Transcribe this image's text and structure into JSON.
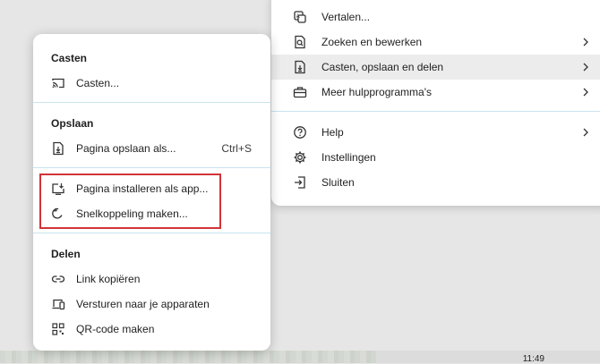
{
  "main_menu": {
    "items": [
      {
        "label": "Vertalen...",
        "icon": "translate-icon",
        "submenu": false
      },
      {
        "label": "Zoeken en bewerken",
        "icon": "search-document-icon",
        "submenu": true
      },
      {
        "label": "Casten, opslaan en delen",
        "icon": "save-document-icon",
        "submenu": true,
        "highlighted": true
      },
      {
        "label": "Meer hulpprogramma's",
        "icon": "toolbox-icon",
        "submenu": true
      },
      {
        "label": "Help",
        "icon": "help-icon",
        "submenu": true
      },
      {
        "label": "Instellingen",
        "icon": "gear-icon",
        "submenu": false
      },
      {
        "label": "Sluiten",
        "icon": "exit-icon",
        "submenu": false
      }
    ]
  },
  "sub_menu": {
    "cast": {
      "heading": "Casten",
      "items": [
        {
          "label": "Casten...",
          "icon": "cast-icon"
        }
      ]
    },
    "save": {
      "heading": "Opslaan",
      "items": [
        {
          "label": "Pagina opslaan als...",
          "shortcut": "Ctrl+S",
          "icon": "save-page-icon"
        },
        {
          "label": "Pagina installeren als app...",
          "icon": "install-app-icon"
        },
        {
          "label": "Snelkoppeling maken...",
          "icon": "shortcut-icon"
        }
      ]
    },
    "share": {
      "heading": "Delen",
      "items": [
        {
          "label": "Link kopiëren",
          "icon": "link-icon"
        },
        {
          "label": "Versturen naar je apparaten",
          "icon": "devices-icon"
        },
        {
          "label": "QR-code maken",
          "icon": "qr-code-icon"
        }
      ]
    }
  },
  "taskbar": {
    "time": "11:49"
  },
  "colors": {
    "highlight_box": "#d13438",
    "divider": "#c9e3ef",
    "hover": "#ececec"
  }
}
